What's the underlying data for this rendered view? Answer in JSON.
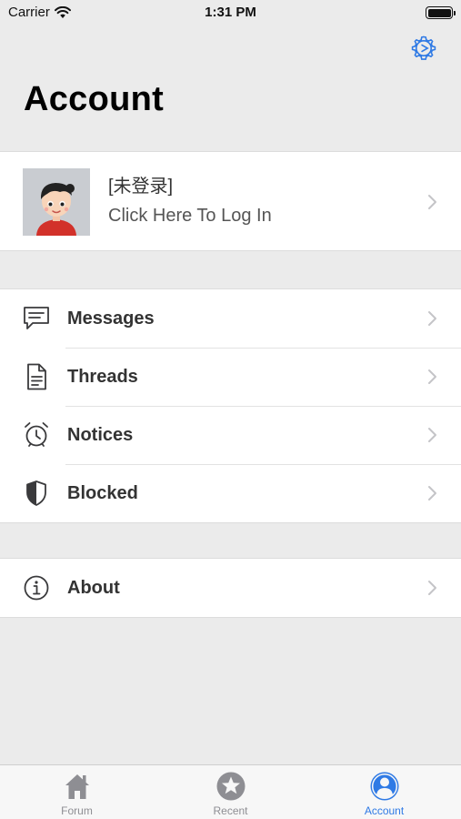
{
  "status_bar": {
    "carrier": "Carrier",
    "time": "1:31 PM"
  },
  "header": {
    "title": "Account"
  },
  "profile": {
    "name": "[未登录]",
    "subtitle": "Click Here To Log In"
  },
  "menu_sections": [
    [
      {
        "label": "Messages",
        "icon": "message-icon"
      },
      {
        "label": "Threads",
        "icon": "document-icon"
      },
      {
        "label": "Notices",
        "icon": "alarm-clock-icon"
      },
      {
        "label": "Blocked",
        "icon": "shield-icon"
      }
    ],
    [
      {
        "label": "About",
        "icon": "info-icon"
      }
    ]
  ],
  "tab_bar": {
    "tabs": [
      {
        "label": "Forum",
        "icon": "home-icon",
        "active": false
      },
      {
        "label": "Recent",
        "icon": "star-icon",
        "active": false
      },
      {
        "label": "Account",
        "icon": "person-icon",
        "active": true
      }
    ]
  },
  "colors": {
    "accent": "#2f7ae5",
    "background": "#ebebeb",
    "inactive_tab": "#8e8e93"
  }
}
